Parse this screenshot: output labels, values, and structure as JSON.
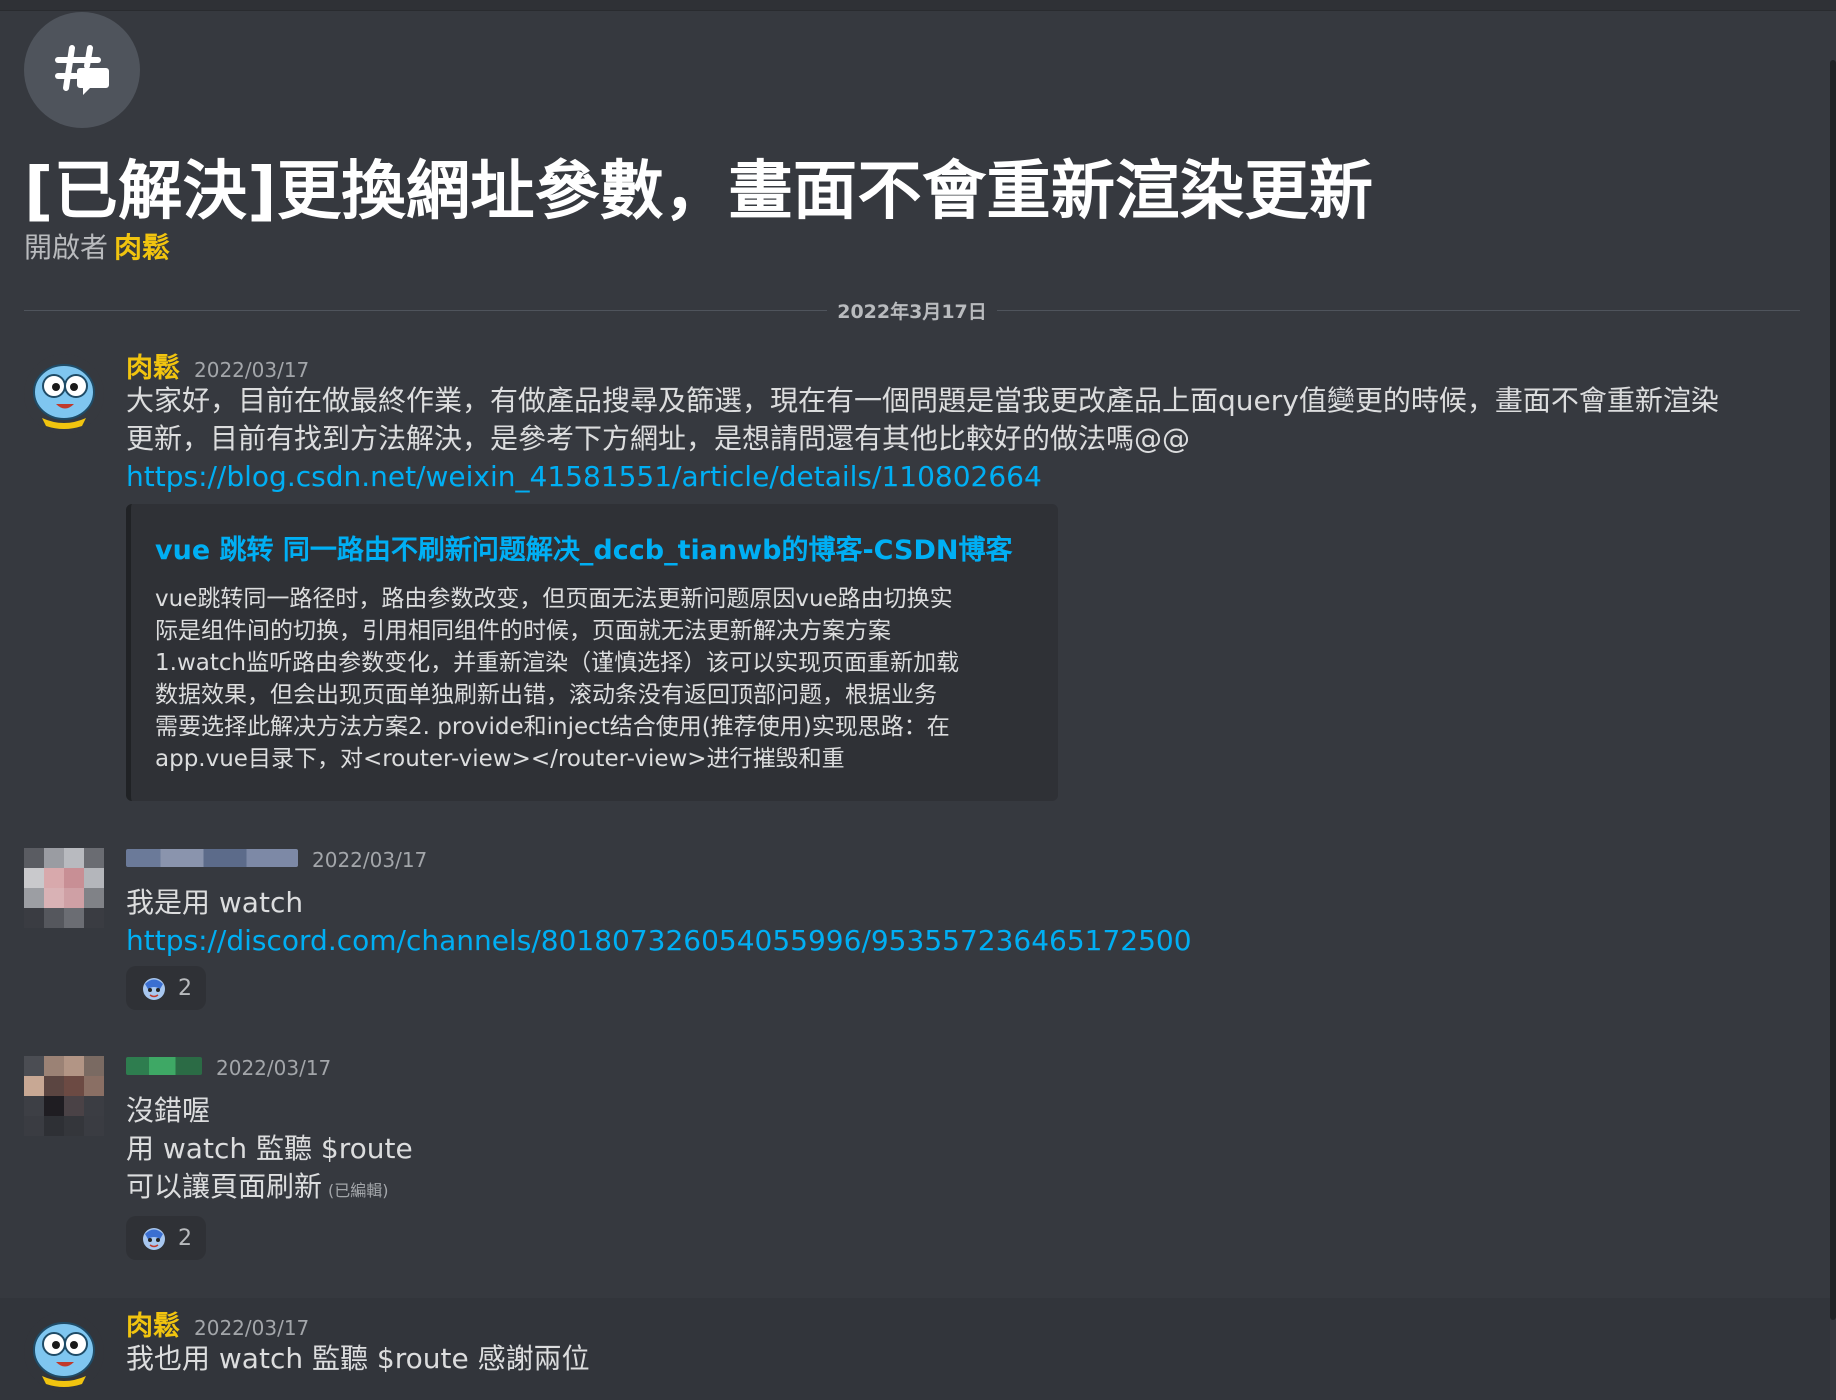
{
  "thread": {
    "title": "[已解決]更換網址參數，畫面不會重新渲染更新",
    "opener_prefix": "開啟者",
    "opener_name": "肉鬆",
    "icon": "thread-icon"
  },
  "date_divider": "2022年3月17日",
  "colors": {
    "background": "#36393f",
    "username_yellow": "#f1c40f",
    "link_blue": "#00aff4",
    "embed_bg": "#2f3136"
  },
  "messages": [
    {
      "username": "肉鬆",
      "timestamp": "2022/03/17",
      "lines": [
        "大家好，目前在做最終作業，有做產品搜尋及篩選，現在有一個問題是當我更改產品上面query值變更的時候，畫面不會重新渲染更新，目前有找到方法解決，是參考下方網址，是想請問還有其他比較好的做法嗎@@"
      ],
      "link": "https://blog.csdn.net/weixin_41581551/article/details/110802664",
      "embed": {
        "title": "vue 跳转 同一路由不刷新问题解决_dccb_tianwb的博客-CSDN博客",
        "description": "vue跳转同一路径时，路由参数改变，但页面无法更新问题原因vue路由切换实\n际是组件间的切换，引用相同组件的时候，页面就无法更新解决方案方案\n1.watch监听路由参数变化，并重新渲染（谨慎选择）该可以实现页面重新加载\n数据效果，但会出现页面单独刷新出错，滚动条没有返回顶部问题，根据业务\n需要选择此解决方法方案2. provide和inject结合使用(推荐使用)实现思路：在\napp.vue目录下，对<router-view></router-view>进行摧毁和重"
      }
    },
    {
      "timestamp": "2022/03/17",
      "lines": [
        "我是用 watch"
      ],
      "link": "https://discord.com/channels/801807326054055996/953557236465172500",
      "reaction": {
        "emoji": "custom-emoji-icon",
        "count": "2"
      }
    },
    {
      "timestamp": "2022/03/17",
      "lines": [
        "沒錯喔",
        "用 watch 監聽 $route",
        "可以讓頁面刷新"
      ],
      "edited": "(已編輯)",
      "reaction": {
        "emoji": "custom-emoji-icon",
        "count": "2"
      }
    },
    {
      "username": "肉鬆",
      "timestamp": "2022/03/17",
      "lines": [
        "我也用 watch 監聽 $route  感謝兩位"
      ]
    }
  ]
}
